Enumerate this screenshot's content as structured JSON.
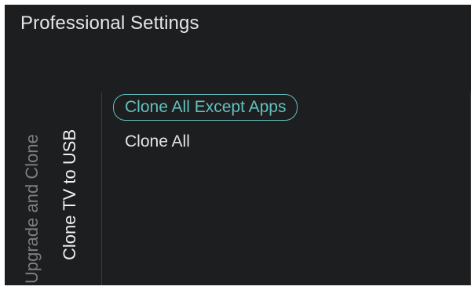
{
  "header": {
    "title": "Professional Settings"
  },
  "breadcrumb": {
    "parent": "Upgrade and Clone",
    "current": "Clone TV to USB"
  },
  "menu": {
    "items": [
      {
        "label": "Clone All Except Apps",
        "selected": true
      },
      {
        "label": "Clone All",
        "selected": false
      }
    ]
  },
  "colors": {
    "background": "#1d1e20",
    "accent": "#62c0be",
    "text": "#e4e4e4",
    "muted_text": "#7d7e80",
    "divider": "#3a3b3d"
  }
}
